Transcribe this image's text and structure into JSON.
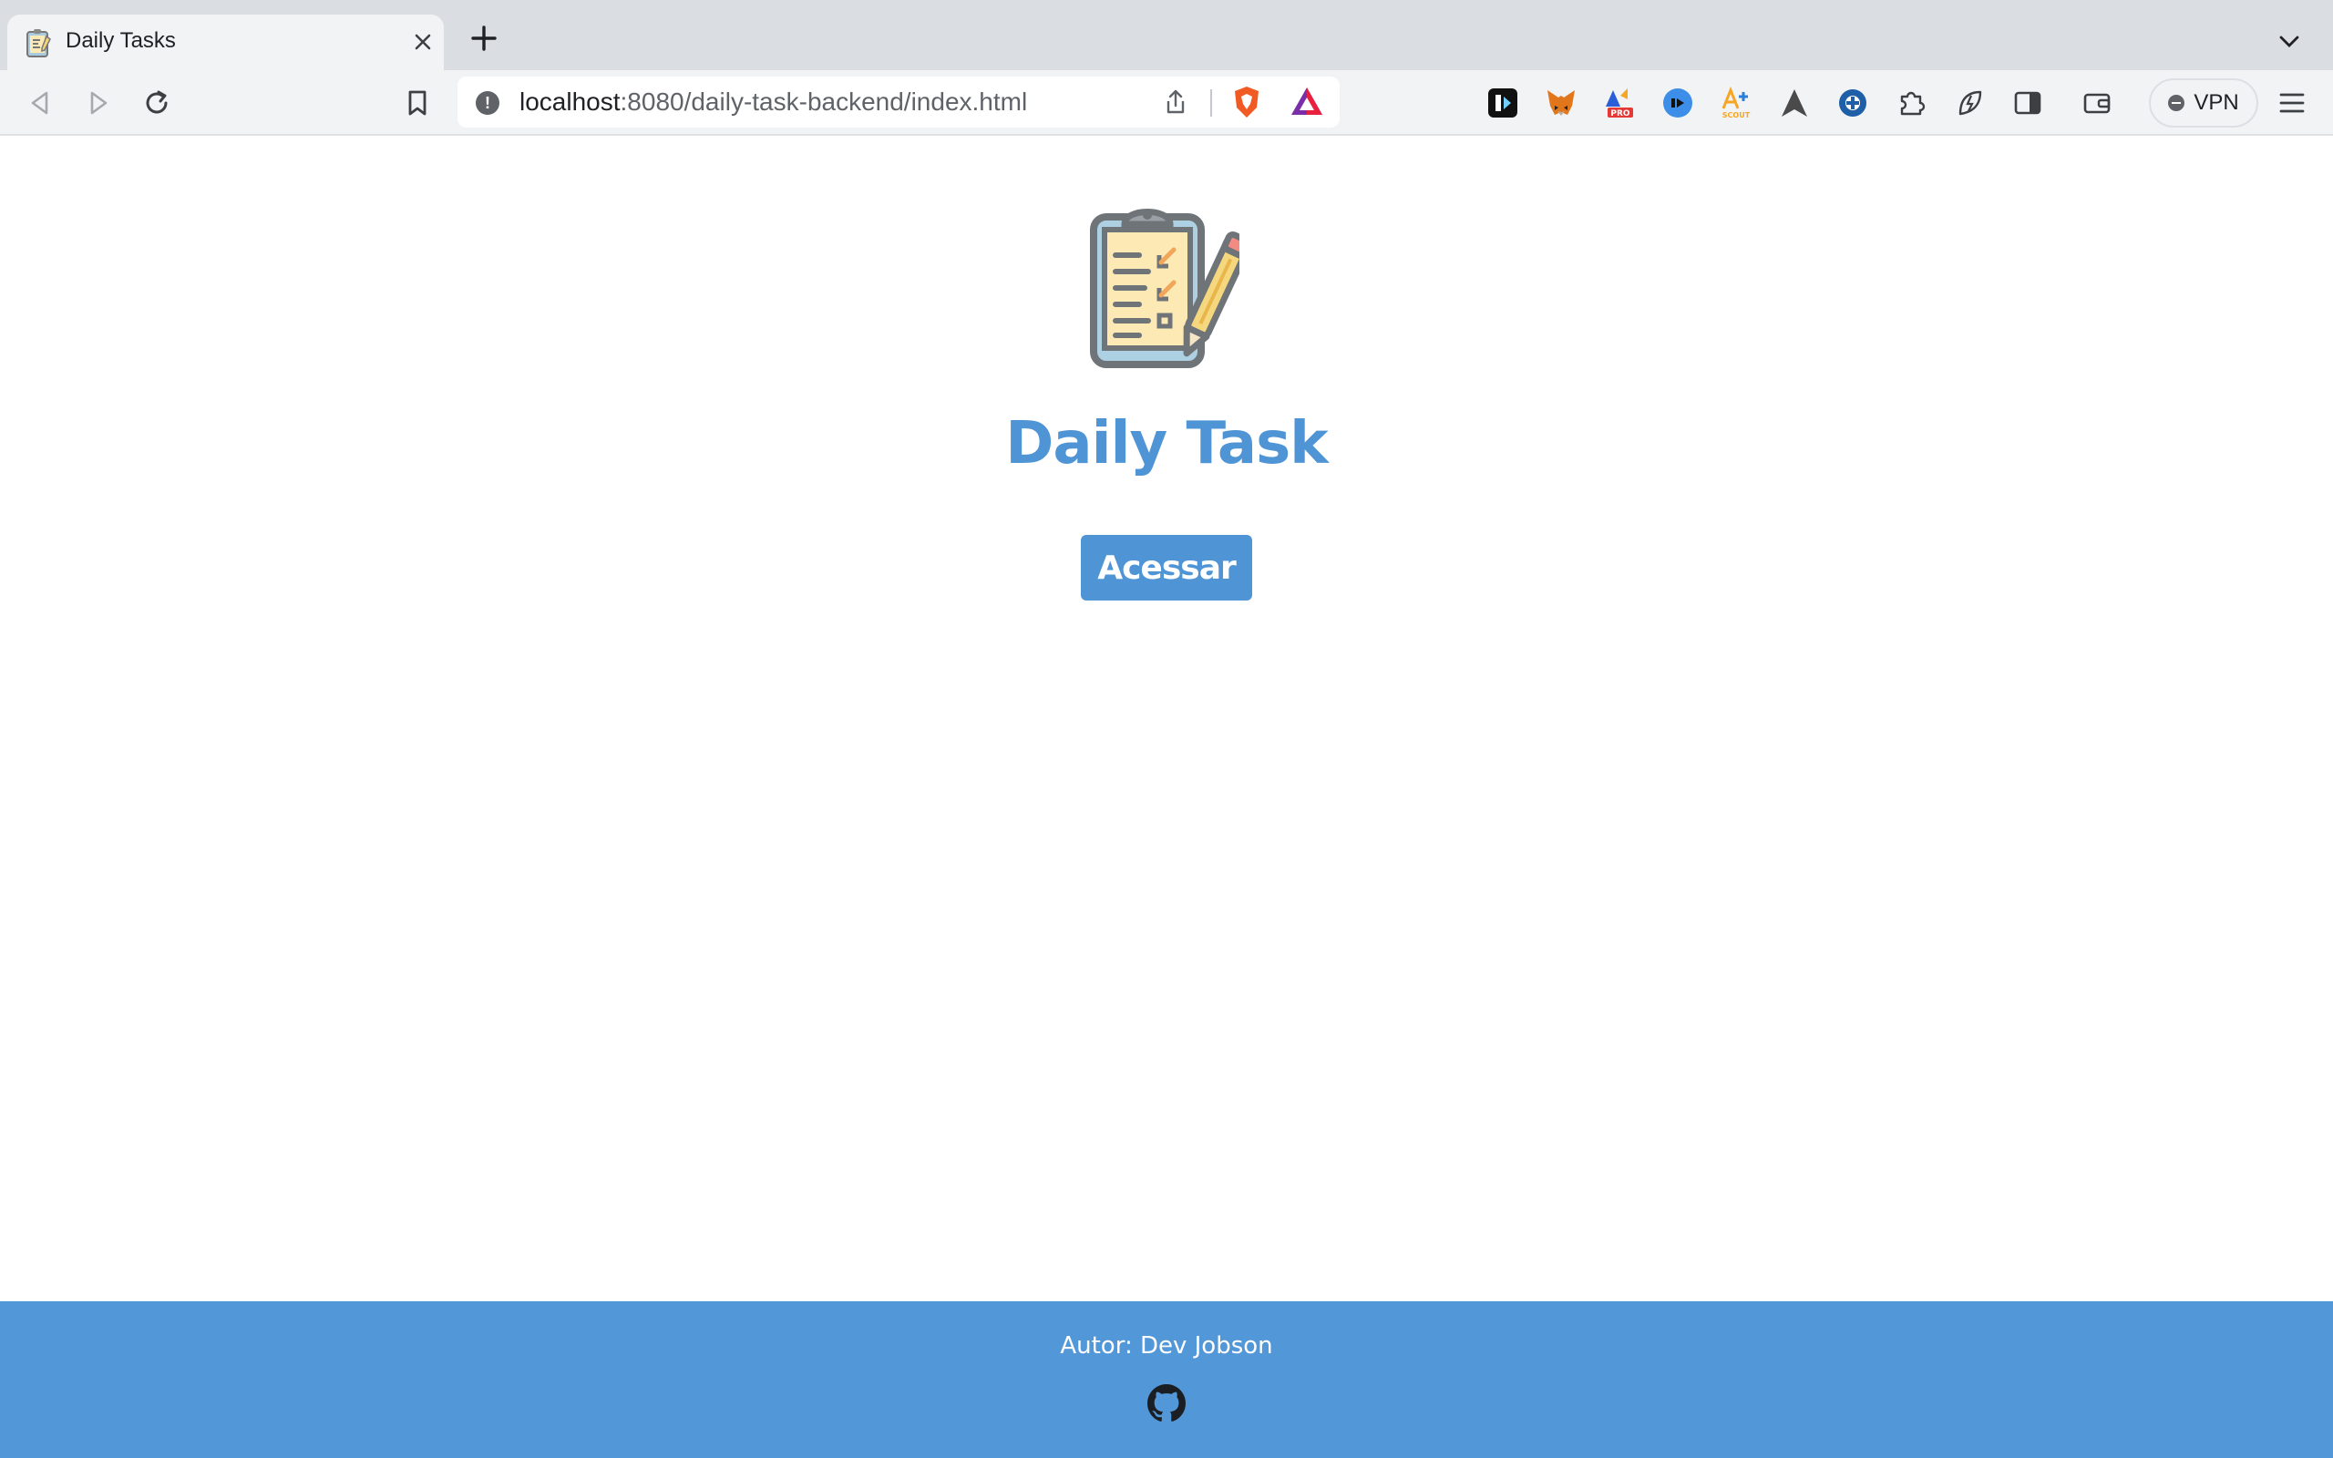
{
  "browser": {
    "tab": {
      "title": "Daily Tasks",
      "favicon": "clipboard-icon"
    },
    "address_bar": {
      "host": "localhost",
      "path": ":8080/daily-task-backend/index.html"
    },
    "vpn_label": "VPN",
    "extensions": [
      "brave-shields-icon",
      "brave-rewards-icon",
      "metamask-icon",
      "fox-icon",
      "pro-icon",
      "audio-icon",
      "scout-icon",
      "arrow-icon",
      "gear-plus-icon",
      "puzzle-icon",
      "leaf-icon",
      "sidebar-icon",
      "wallet-icon"
    ]
  },
  "page": {
    "logo": "clipboard-checklist-icon",
    "title": "Daily Task",
    "access_button": "Acessar"
  },
  "footer": {
    "author": "Autor: Dev Jobson",
    "link_icon": "github-icon"
  },
  "colors": {
    "brand": "#4f95d5",
    "footer": "#5298d8"
  }
}
